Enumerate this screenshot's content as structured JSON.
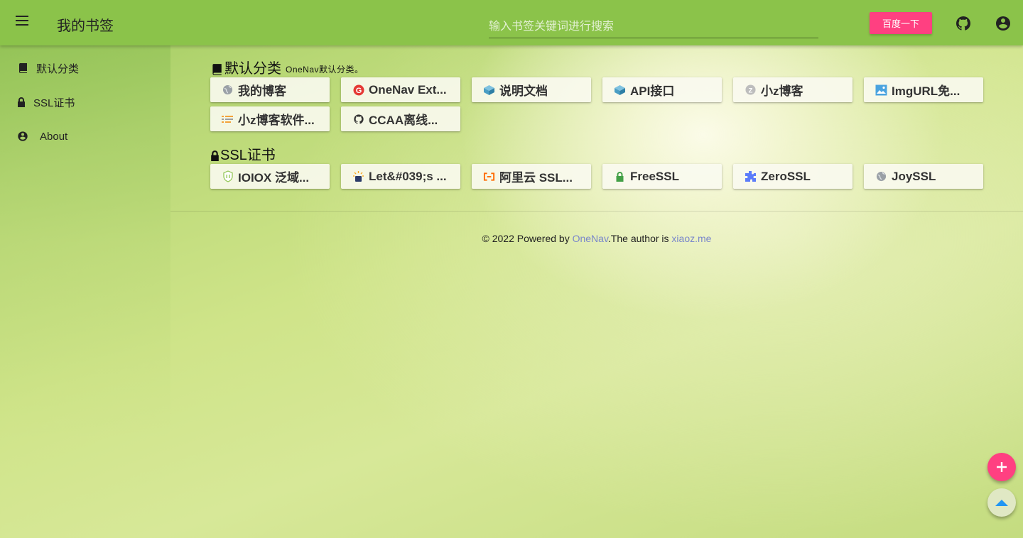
{
  "header": {
    "brand": "我的书签",
    "search_placeholder": "输入书签关键词进行搜索",
    "search_button": "百度一下"
  },
  "sidebar": {
    "items": [
      {
        "label": "默认分类",
        "icon": "book-icon"
      },
      {
        "label": "SSL证书",
        "icon": "lock-icon"
      },
      {
        "label": "About",
        "icon": "account-circle-icon"
      }
    ]
  },
  "categories": [
    {
      "title": "默认分类",
      "description": "OneNav默认分类。",
      "icon": "book-icon",
      "links": [
        {
          "label": "我的博客",
          "icon": "globe-icon"
        },
        {
          "label": "OneNav Ext...",
          "icon": "onenav-logo-icon"
        },
        {
          "label": "说明文档",
          "icon": "cube-icon"
        },
        {
          "label": "API接口",
          "icon": "cube-icon"
        },
        {
          "label": "小z博客",
          "icon": "z-logo-icon"
        },
        {
          "label": "ImgURL免...",
          "icon": "image-icon"
        },
        {
          "label": "小z博客软件...",
          "icon": "list-icon"
        },
        {
          "label": "CCAA离线...",
          "icon": "github-icon"
        }
      ]
    },
    {
      "title": "SSL证书",
      "description": "",
      "icon": "lock-icon",
      "links": [
        {
          "label": "IOIOX 泛域...",
          "icon": "shield-icon"
        },
        {
          "label": "Let&#039;s ...",
          "icon": "letsencrypt-icon"
        },
        {
          "label": "阿里云 SSL...",
          "icon": "aliyun-icon"
        },
        {
          "label": "FreeSSL",
          "icon": "lock-icon"
        },
        {
          "label": "ZeroSSL",
          "icon": "puzzle-icon"
        },
        {
          "label": "JoySSL",
          "icon": "globe-icon"
        }
      ]
    }
  ],
  "footer": {
    "prefix": "© 2022 Powered by ",
    "link1": "OneNav",
    "middle": ".The author is ",
    "link2": "xiaoz.me"
  },
  "colors": {
    "topbar": "#8bc34a",
    "accent": "#ff4081",
    "link": "#7986cb"
  }
}
